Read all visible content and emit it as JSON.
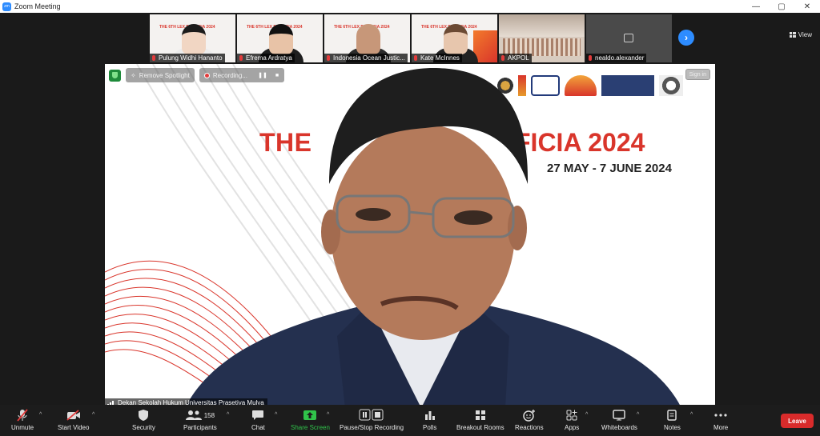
{
  "window": {
    "title": "Zoom Meeting",
    "controls": [
      "—",
      "▢",
      "✕"
    ]
  },
  "stage": {
    "view_label": "View",
    "participants_strip": [
      {
        "name": "Pulung Widhi Hananto",
        "muted": true
      },
      {
        "name": "Efrema Ardratya",
        "muted": true
      },
      {
        "name": "Indonesia Ocean Justic...",
        "muted": true
      },
      {
        "name": "Kate McInnes",
        "muted": true
      },
      {
        "name": "AKPOL",
        "muted": true
      },
      {
        "name": "nealdo.alexander",
        "muted": true
      }
    ],
    "thumb_slide_title": "THE 6TH LEX PROFICIA 2024",
    "thumb_slide_title_partial": "LEX PROFICIA 2024",
    "next_icon": "›"
  },
  "main_video": {
    "speaker_name": "Dekan Sekolah Hukum Universitas Prasetiya Mulya",
    "overlay": {
      "remove_spotlight": "Remove Spotlight",
      "recording": "Recording...",
      "pause_icon": "❚❚",
      "stop_icon": "■",
      "sign_in": "Sign in"
    },
    "slide": {
      "title_left": "THE",
      "title_right": "FICIA 2024",
      "dates": "27 MAY - 7 JUNE 2024"
    }
  },
  "toolbar": {
    "items": [
      {
        "label": "Unmute",
        "icon": "microphone-muted-icon"
      },
      {
        "label": "Start Video",
        "icon": "camera-off-icon"
      },
      {
        "label": "Security",
        "icon": "shield-icon"
      },
      {
        "label": "Participants",
        "icon": "people-icon",
        "count": "158"
      },
      {
        "label": "Chat",
        "icon": "chat-icon"
      },
      {
        "label": "Share Screen",
        "icon": "share-screen-icon"
      },
      {
        "label": "Pause/Stop Recording",
        "icon": "recording-controls-icon"
      },
      {
        "label": "Polls",
        "icon": "polls-icon"
      },
      {
        "label": "Breakout Rooms",
        "icon": "breakout-rooms-icon"
      },
      {
        "label": "Reactions",
        "icon": "reactions-icon"
      },
      {
        "label": "Apps",
        "icon": "apps-icon"
      },
      {
        "label": "Whiteboards",
        "icon": "whiteboard-icon"
      },
      {
        "label": "Notes",
        "icon": "notes-icon"
      },
      {
        "label": "More",
        "icon": "more-icon"
      }
    ],
    "leave_label": "Leave",
    "caret": "^"
  },
  "colors": {
    "zoom_blue": "#2d8cff",
    "leave_red": "#d92b2b",
    "slide_red": "#d9352b",
    "share_green": "#30c24a"
  }
}
